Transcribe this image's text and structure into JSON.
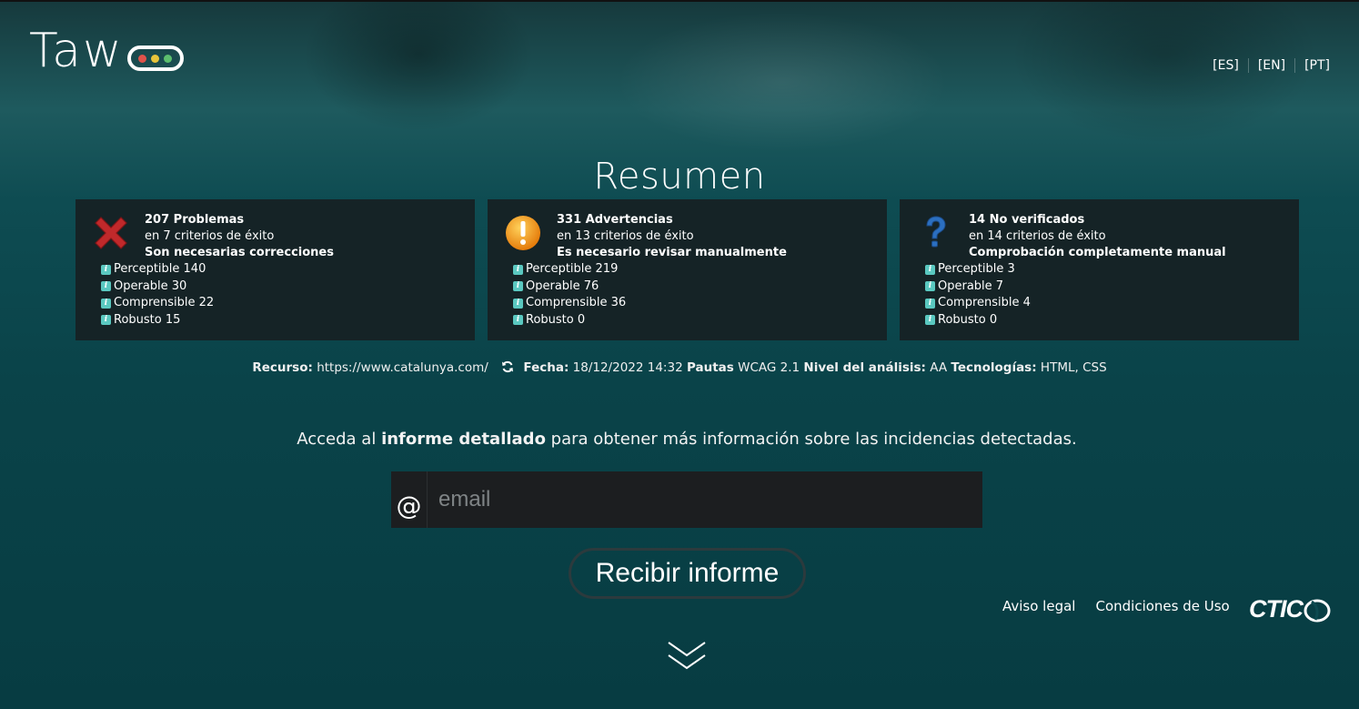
{
  "brand": {
    "logo_text": "Taw",
    "dots": [
      "#e0524a",
      "#e8c43a",
      "#5cbf6e"
    ]
  },
  "languages": [
    "[ES]",
    "[EN]",
    "[PT]"
  ],
  "page_title": "Resumen",
  "cards": [
    {
      "icon": "error-x-icon",
      "count_label": "207 Problemas",
      "criteria": "en 7 criterios de éxito",
      "note": "Son necesarias correcciones",
      "items": [
        "Perceptible 140",
        "Operable 30",
        "Comprensible 22",
        "Robusto 15"
      ]
    },
    {
      "icon": "warning-icon",
      "count_label": "331 Advertencias",
      "criteria": "en 13 criterios de éxito",
      "note": "Es necesario revisar manualmente",
      "items": [
        "Perceptible 219",
        "Operable 76",
        "Comprensible 36",
        "Robusto 0"
      ]
    },
    {
      "icon": "question-icon",
      "count_label": "14 No verificados",
      "criteria": "en 14 criterios de éxito",
      "note": "Comprobación completamente manual",
      "items": [
        "Perceptible 3",
        "Operable 7",
        "Comprensible 4",
        "Robusto 0"
      ]
    }
  ],
  "meta": {
    "resource_label": "Recurso:",
    "resource_value": "https://www.catalunya.com/",
    "date_label": "Fecha:",
    "date_value": "18/12/2022 14:32",
    "guidelines_label": "Pautas",
    "guidelines_value": "WCAG 2.1",
    "level_label": "Nivel del análisis:",
    "level_value": "AA",
    "tech_label": "Tecnologías:",
    "tech_value": "HTML, CSS"
  },
  "access": {
    "prefix": "Acceda al ",
    "bold": "informe detallado",
    "suffix": " para obtener más información sobre las incidencias detectadas."
  },
  "email": {
    "at_symbol": "@",
    "placeholder": "email",
    "value": ""
  },
  "receive_button": "Recibir informe",
  "footer": {
    "legal": "Aviso legal",
    "terms": "Condiciones de Uso",
    "ctic": "CTIC"
  },
  "colors": {
    "background": "#0d4a50",
    "card": "#152326",
    "info": "#5ac8c0"
  }
}
